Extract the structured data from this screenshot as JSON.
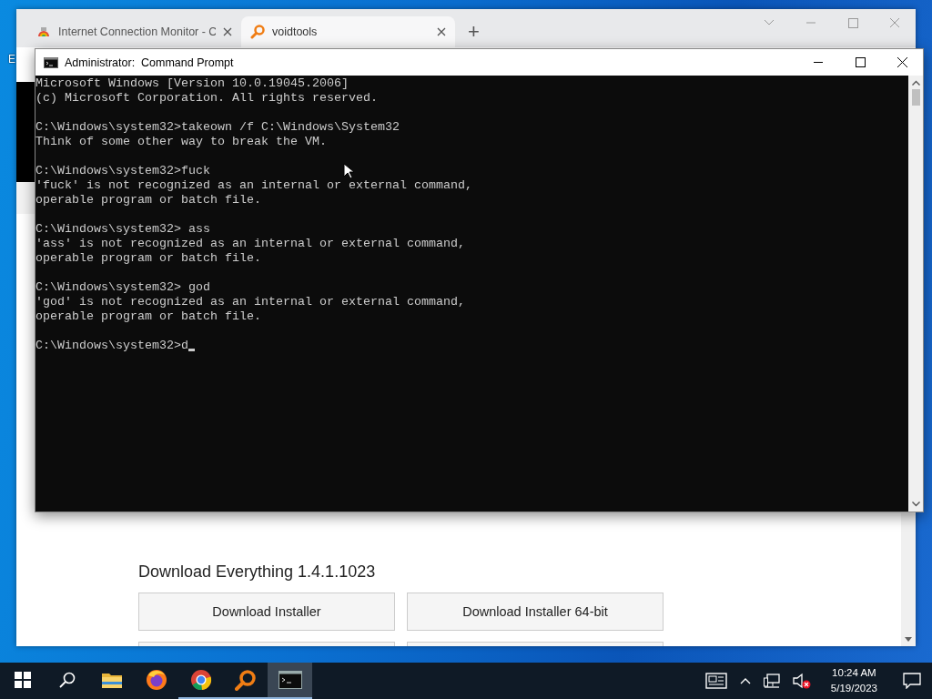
{
  "desktop": {
    "icon_labels": [
      "E"
    ]
  },
  "browser": {
    "tabs": [
      {
        "title": "Internet Connection Monitor - C",
        "kind": "monitor",
        "selected": false
      },
      {
        "title": "voidtools",
        "kind": "everything",
        "selected": true
      }
    ],
    "new_tab": "+",
    "page": {
      "heading": "Download Everything 1.4.1.1023",
      "buttons": [
        "Download Installer",
        "Download Installer 64-bit"
      ]
    }
  },
  "console": {
    "title": "Administrator:  Command Prompt",
    "blocks": [
      [
        "Microsoft Windows [Version 10.0.19045.2006]",
        "(c) Microsoft Corporation. All rights reserved."
      ],
      [
        "C:\\Windows\\system32>takeown /f C:\\Windows\\System32",
        "Think of some other way to break the VM."
      ],
      [
        "C:\\Windows\\system32>fuck",
        "'fuck' is not recognized as an internal or external command,",
        "operable program or batch file."
      ],
      [
        "C:\\Windows\\system32> ass",
        "'ass' is not recognized as an internal or external command,",
        "operable program or batch file."
      ],
      [
        "C:\\Windows\\system32> god",
        "'god' is not recognized as an internal or external command,",
        "operable program or batch file."
      ]
    ],
    "prompt": "C:\\Windows\\system32>d"
  },
  "taskbar": {
    "apps": [
      {
        "kind": "start",
        "running": false,
        "selected": false
      },
      {
        "kind": "search",
        "running": false,
        "selected": false
      },
      {
        "kind": "explorer",
        "running": false,
        "selected": false
      },
      {
        "kind": "firefox",
        "running": false,
        "selected": false
      },
      {
        "kind": "chrome",
        "running": true,
        "selected": false
      },
      {
        "kind": "everything",
        "running": true,
        "selected": false
      },
      {
        "kind": "terminal",
        "running": true,
        "selected": true
      }
    ],
    "tray": [
      {
        "kind": "news"
      },
      {
        "kind": "chevron"
      },
      {
        "kind": "network"
      },
      {
        "kind": "volume",
        "muted": true
      }
    ],
    "clock": {
      "time": "10:24 AM",
      "date": "5/19/2023"
    }
  }
}
